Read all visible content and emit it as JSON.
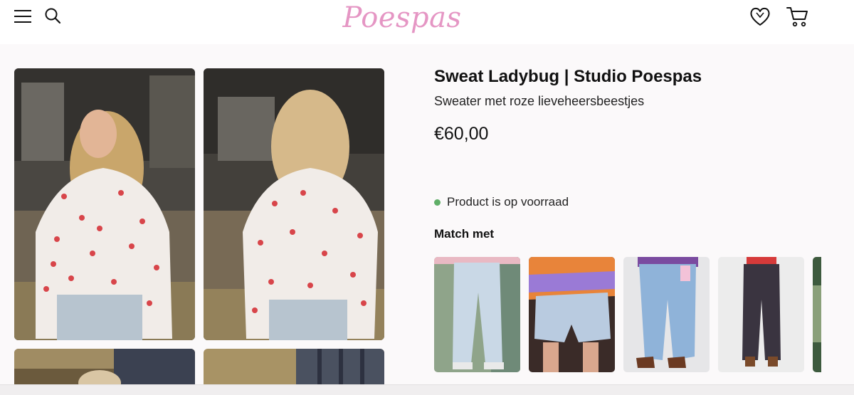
{
  "header": {
    "logo_text": "Poespas",
    "menu_icon": "hamburger-menu-icon",
    "search_icon": "search-icon",
    "wishlist_icon": "heart-icon",
    "cart_icon": "cart-icon"
  },
  "product": {
    "title": "Sweat Ladybug | Studio Poespas",
    "subtitle": "Sweater met roze lieveheersbeestjes",
    "price": "€60,00",
    "stock_status": "Product is op voorraad",
    "stock_color": "#5fae67"
  },
  "match": {
    "title": "Match met"
  },
  "colors": {
    "brand_pink": "#e596c4",
    "background": "#fbf9fa",
    "header_bg": "#ffffff"
  }
}
